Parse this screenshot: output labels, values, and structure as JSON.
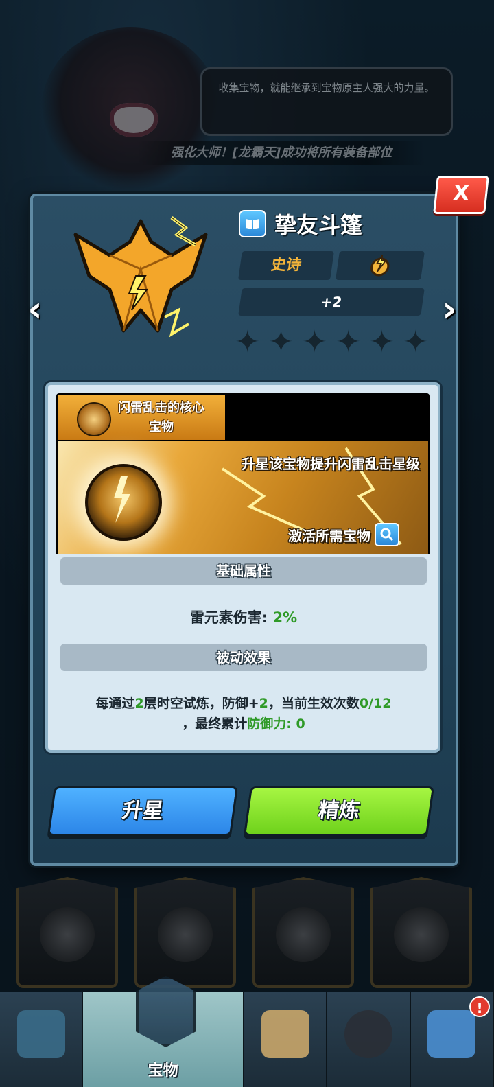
{
  "background": {
    "speech_bubble": "收集宝物，就能继承到宝物原主人强大的力量。",
    "ticker": "强化大师！[龙霸天]成功将所有装备部位"
  },
  "dialog": {
    "close_label": "X",
    "nav_left": "‹",
    "nav_right": "›",
    "item_name": "挚友斗篷",
    "rarity": "史诗",
    "element_icon": "lightning-fist-icon",
    "level": "+2",
    "stars_filled": 0,
    "stars_total": 6,
    "core": {
      "tag_line1": "闪雷乱击的核心",
      "tag_line2": "宝物",
      "description": "升星该宝物提升闪雷乱击星级",
      "activate_label": "激活所需宝物"
    },
    "basic_header": "基础属性",
    "stat_label": "雷元素伤害: ",
    "stat_value": "2%",
    "passive_header": "被动效果",
    "passive": {
      "p1": "每通过",
      "p2": "2",
      "p3": "层时空试炼，防御+",
      "p4": "2",
      "p5": "，当前生效次数",
      "p6": "0/12",
      "p7": "，最终累计",
      "p8": "防御力: 0"
    },
    "btn_star": "升星",
    "btn_refine": "精炼"
  },
  "bottom_nav": {
    "tabs": [
      {
        "label": "",
        "icon": "crystal-tab-icon"
      },
      {
        "label": "宝物",
        "icon": "treasure-tab-icon",
        "active": true
      },
      {
        "label": "",
        "icon": "map-tab-icon"
      },
      {
        "label": "",
        "icon": "heroes-tab-icon"
      },
      {
        "label": "",
        "icon": "cards-tab-icon",
        "badge": "!"
      }
    ]
  },
  "colors": {
    "accent_blue": "#2c86e8",
    "accent_green": "#6fd21c",
    "epic_gold": "#f3b43a",
    "stat_green": "#2f9a28"
  }
}
